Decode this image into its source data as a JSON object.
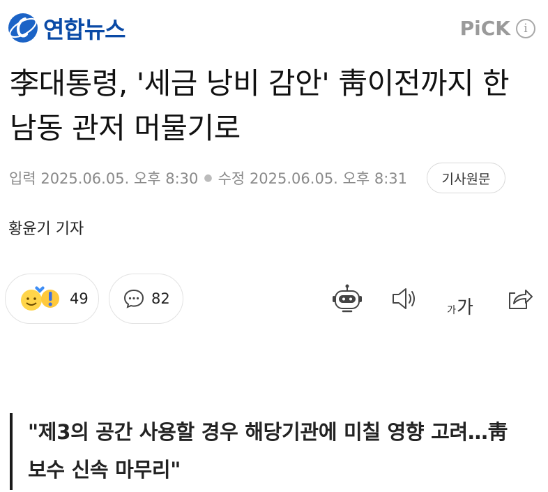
{
  "header": {
    "logo_text": "연합뉴스",
    "pick_label": "PiCK",
    "info_label": "i"
  },
  "article": {
    "headline": "李대통령, '세금 낭비 감안' 靑이전까지 한남동 관저 머물기로",
    "published_label": "입력",
    "published": "2025.06.05. 오후 8:30",
    "modified_label": "수정",
    "modified": "2025.06.05. 오후 8:31",
    "original_button": "기사원문",
    "reporter": "황윤기 기자",
    "subheadline": "\"제3의 공간 사용할 경우 해당기관에 미칠 영향 고려…靑 보수 신속 마무리\""
  },
  "actions": {
    "reaction_count": "49",
    "comment_count": "82",
    "font_small": "가",
    "font_big": "가"
  },
  "colors": {
    "brand": "#0a4aa6",
    "muted": "#8a8a8a"
  }
}
